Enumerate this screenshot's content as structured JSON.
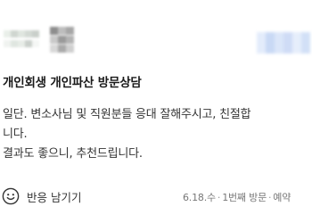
{
  "author": {
    "avatar_colors": [
      "#e9efe9",
      "#cfd6d0",
      "#dfe5df",
      "#d3d9d4",
      "#c9cfca",
      "#f0f3f0",
      "#dfe6e0",
      "#e7ece7",
      "#cad0cb",
      "#f5f7f5"
    ],
    "name_colors": [
      "#8d8d8d",
      "#bdbdbd",
      "#a6a6a6",
      "#c9c9c9",
      "#9a9a9a",
      "#b3b3b3",
      "#d8d8d8",
      "#aaaaaa",
      "#cfcfcf"
    ],
    "follow_colors": [
      "#e3ecfb",
      "#c9d9f5",
      "#dbe6f9",
      "#cfdcf6",
      "#e6eefb",
      "#d2e0f7"
    ]
  },
  "visit": {
    "title": "개인회생 개인파산 방문상담"
  },
  "review": {
    "lines": [
      "일단. 변소사님 및 직원분들 응대 잘해주시고, 친절합",
      "니다.",
      "결과도 좋으니, 추천드립니다."
    ]
  },
  "footer": {
    "react_label": "반응 남기기",
    "date": "6.18.수",
    "visit_count": "1번째 방문",
    "reservation": "예약"
  },
  "colors": {
    "text_primary": "#1a1a1a",
    "text_body": "#333333",
    "text_meta": "#777777"
  }
}
